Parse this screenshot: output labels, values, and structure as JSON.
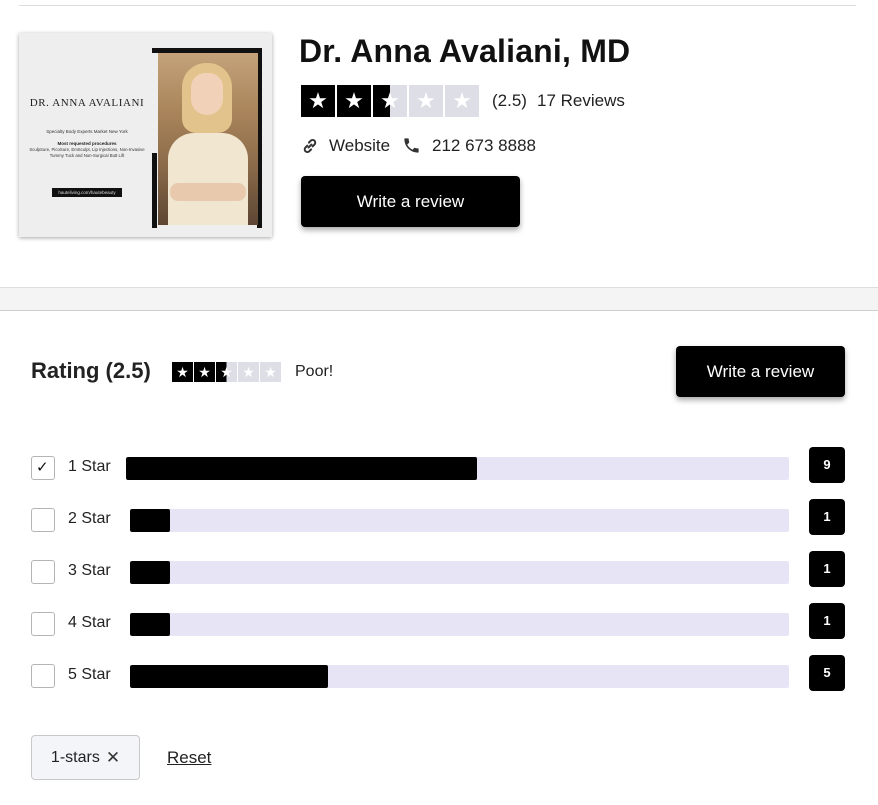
{
  "profile": {
    "name": "Dr. Anna Avaliani, MD",
    "rating_display": "(2.5)",
    "reviews_count": "17 Reviews",
    "rating_value": 2.5,
    "website_label": "Website",
    "phone": "212 673 8888",
    "write_review_label": "Write a review",
    "card": {
      "name": "DR. ANNA AVALIANI",
      "specialty": "Specialty Body Experts Market New York",
      "procedures_title": "Most requested procedures",
      "procedures": "SculpSure, PicoSure, EmSculpt, Lip Injections, Non-Invasive Tummy Tuck and Non-Surgical Butt Lift",
      "link": "hauteliving.com/hautebeauty"
    }
  },
  "rating_section": {
    "heading": "Rating (2.5)",
    "rating_value": 2.5,
    "rating_word": "Poor!",
    "write_review_label": "Write a review"
  },
  "distribution": [
    {
      "label": "1 Star",
      "count": "9",
      "fraction": 0.53,
      "checked": true
    },
    {
      "label": "2 Star",
      "count": "1",
      "fraction": 0.06,
      "checked": false
    },
    {
      "label": "3 Star",
      "count": "1",
      "fraction": 0.06,
      "checked": false
    },
    {
      "label": "4 Star",
      "count": "1",
      "fraction": 0.06,
      "checked": false
    },
    {
      "label": "5 Star",
      "count": "5",
      "fraction": 0.3,
      "checked": false
    }
  ],
  "filters": {
    "chip_label": "1-stars",
    "chip_close": "✕",
    "reset_label": "Reset"
  },
  "icons": {
    "star": "★",
    "check": "✓"
  },
  "colors": {
    "bar_track": "#e6e4f5",
    "bar_fill": "#000000",
    "star_empty": "#dedee6"
  }
}
